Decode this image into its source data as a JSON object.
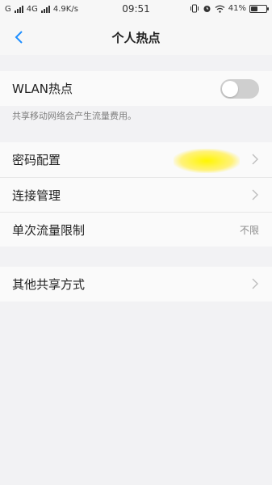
{
  "status_bar": {
    "carrier1": "G",
    "carrier2": "4G",
    "net_speed": "4.9K/s",
    "time": "09:51",
    "battery": "41%",
    "battery_level": 0.41,
    "icons": [
      "signal-icon",
      "vibrate-icon",
      "alarm-icon",
      "wifi-icon",
      "battery-icon"
    ]
  },
  "nav": {
    "title": "个人热点",
    "back_icon": "chevron-left-icon",
    "accent_color": "#1e8fff"
  },
  "wlan": {
    "label": "WLAN热点",
    "toggle_on": false,
    "note": "共享移动网络会产生流量费用。"
  },
  "settings": {
    "items": [
      {
        "label": "密码配置",
        "has_chevron": true
      },
      {
        "label": "连接管理",
        "has_chevron": true
      },
      {
        "label": "单次流量限制",
        "value": "不限"
      }
    ]
  },
  "other": {
    "label": "其他共享方式"
  }
}
